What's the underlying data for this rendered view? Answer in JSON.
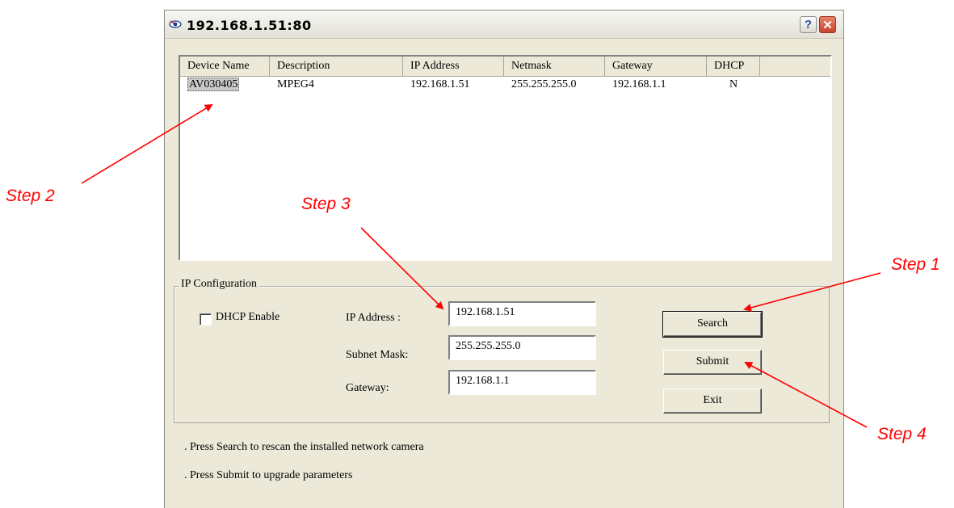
{
  "window": {
    "title": "192.168.1.51:80",
    "help_label": "?",
    "close_label": "✕"
  },
  "list": {
    "columns": [
      "Device Name",
      "Description",
      "IP Address",
      "Netmask",
      "Gateway",
      "DHCP"
    ],
    "rows": [
      {
        "device_name": "AV030405",
        "description": "MPEG4",
        "ip_address": "192.168.1.51",
        "netmask": "255.255.255.0",
        "gateway": "192.168.1.1",
        "dhcp": "N"
      }
    ]
  },
  "ip_config": {
    "legend": "IP Configuration",
    "dhcp_label": "DHCP Enable",
    "dhcp_checked": false,
    "ip_label": "IP Address :",
    "ip_value": "192.168.1.51",
    "mask_label": "Subnet Mask:",
    "mask_value": "255.255.255.0",
    "gateway_label": "Gateway:",
    "gateway_value": "192.168.1.1"
  },
  "buttons": {
    "search": "Search",
    "submit": "Submit",
    "exit": "Exit"
  },
  "hints": [
    ". Press Search to rescan the installed network camera",
    ". Press Submit to upgrade parameters"
  ],
  "annotations": {
    "step1": "Step 1",
    "step2": "Step 2",
    "step3": "Step 3",
    "step4": "Step 4",
    "color": "#ff0000"
  }
}
